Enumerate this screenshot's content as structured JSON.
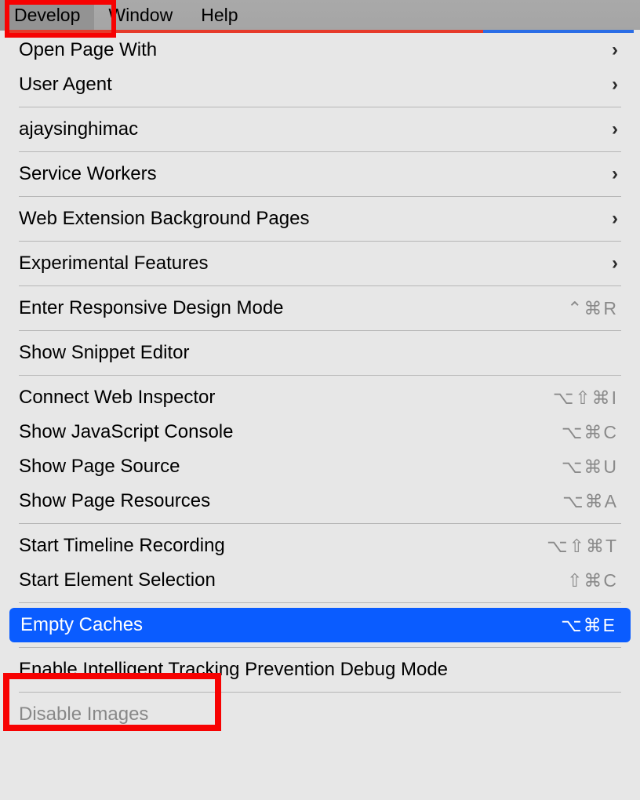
{
  "menubar": {
    "develop": "Develop",
    "window": "Window",
    "help": "Help"
  },
  "menu": {
    "open_page_with": "Open Page With",
    "user_agent": "User Agent",
    "device": "ajaysinghimac",
    "service_workers": "Service Workers",
    "web_ext_bg": "Web Extension Background Pages",
    "experimental": "Experimental Features",
    "responsive": "Enter Responsive Design Mode",
    "responsive_sc": "⌃⌘R",
    "snippet": "Show Snippet Editor",
    "connect_inspector": "Connect Web Inspector",
    "connect_inspector_sc": "⌥⇧⌘I",
    "js_console": "Show JavaScript Console",
    "js_console_sc": "⌥⌘C",
    "page_source": "Show Page Source",
    "page_source_sc": "⌥⌘U",
    "page_resources": "Show Page Resources",
    "page_resources_sc": "⌥⌘A",
    "timeline": "Start Timeline Recording",
    "timeline_sc": "⌥⇧⌘T",
    "element_selection": "Start Element Selection",
    "element_selection_sc": "⇧⌘C",
    "empty_caches": "Empty Caches",
    "empty_caches_sc": "⌥⌘E",
    "itp": "Enable Intelligent Tracking Prevention Debug Mode",
    "disable_images": "Disable Images"
  },
  "chevron": "›"
}
